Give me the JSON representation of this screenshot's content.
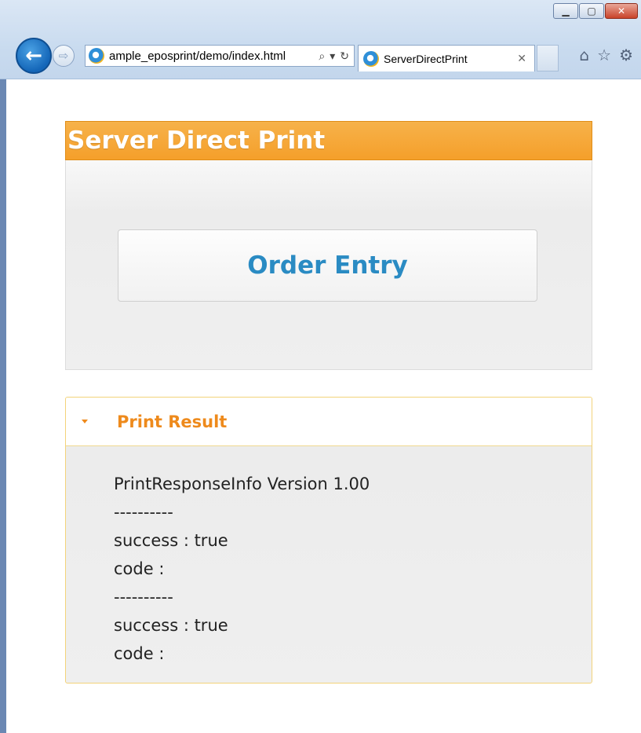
{
  "browser": {
    "address_url": "ample_eposprint/demo/index.html",
    "tab_title": "ServerDirectPrint"
  },
  "page": {
    "header_title": "Server Direct Print",
    "order_button_label": "Order Entry",
    "result_heading": "Print Result",
    "result_lines": [
      "PrintResponseInfo Version 1.00",
      "----------",
      "success : true",
      "code :",
      "----------",
      "success : true",
      "code :"
    ]
  },
  "colors": {
    "header_orange": "#f5a93a",
    "order_text_blue": "#2a8bc3",
    "result_heading_orange": "#ee8a1c"
  }
}
